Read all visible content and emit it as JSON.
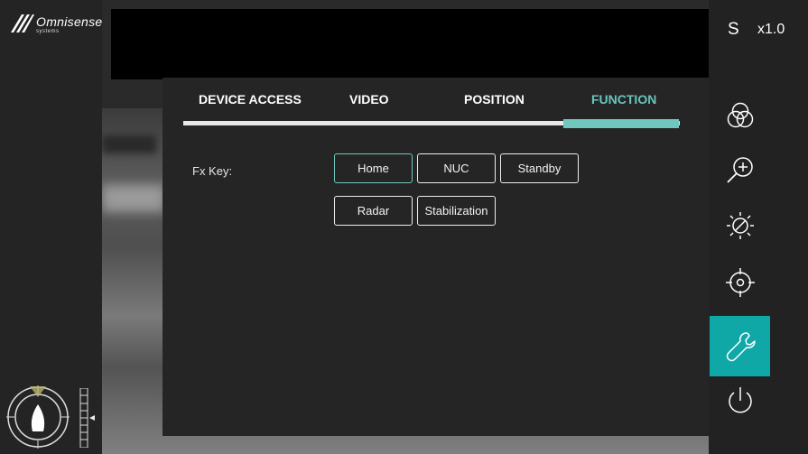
{
  "brand": {
    "name": "Omnisense",
    "sub": "systems"
  },
  "status": {
    "mode_letter": "S",
    "zoom_level": "x1.0"
  },
  "tabs": [
    {
      "label": "DEVICE ACCESS"
    },
    {
      "label": "VIDEO"
    },
    {
      "label": "POSITION"
    },
    {
      "label": "FUNCTION"
    }
  ],
  "active_tab": "FUNCTION",
  "function_panel": {
    "fx_key_label": "Fx Key:",
    "buttons": [
      "Home",
      "NUC",
      "Standby",
      "Radar",
      "Stabilization"
    ],
    "selected_button": "Home"
  },
  "side_toolbar": {
    "items": [
      "color-palette-icon",
      "zoom-in-icon",
      "brightness-icon",
      "crosshair-icon",
      "settings-wrench-icon",
      "power-icon"
    ],
    "active_item": "settings-wrench-icon"
  },
  "colors": {
    "accent": "#0fa8a6",
    "tab_active": "#66c6bd",
    "panel_bg": "#262525"
  }
}
